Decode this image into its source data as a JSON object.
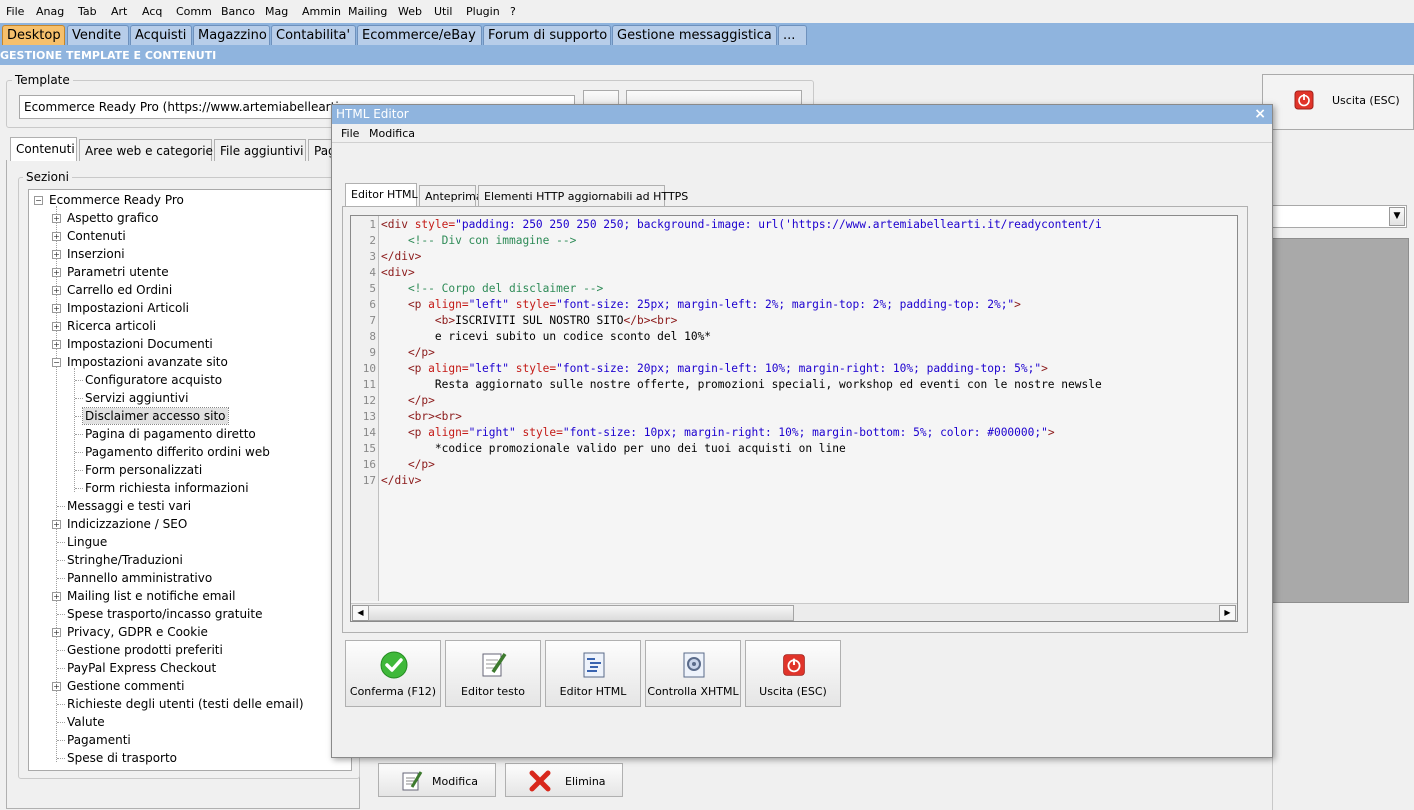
{
  "menubar": [
    "File",
    "Anag",
    "Tab",
    "Art",
    "Acq",
    "Comm",
    "Banco",
    "Mag",
    "Ammin",
    "Mailing",
    "Web",
    "Util",
    "Plugin",
    "?"
  ],
  "tabs": [
    "Desktop",
    "Vendite",
    "Acquisti",
    "Magazzino",
    "Contabilita'",
    "Ecommerce/eBay",
    "Forum di supporto",
    "Gestione messaggistica",
    "..."
  ],
  "section_title": "GESTIONE TEMPLATE E CONTENUTI",
  "template": {
    "legend": "Template",
    "value": "Ecommerce Ready Pro (https://www.artemiabellearti."
  },
  "exit_main": "Uscita (ESC)",
  "subtabs": [
    "Contenuti",
    "Aree web e categorie",
    "File aggiuntivi",
    "Pag"
  ],
  "sections_legend": "Sezioni",
  "tree": {
    "root": "Ecommerce Ready Pro",
    "items": [
      "Aspetto grafico",
      "Contenuti",
      "Inserzioni",
      "Parametri utente",
      "Carrello ed Ordini",
      "Impostazioni Articoli",
      "Ricerca articoli",
      "Impostazioni Documenti",
      "Impostazioni avanzate sito"
    ],
    "children": [
      "Configuratore acquisto",
      "Servizi aggiuntivi",
      "Disclaimer accesso sito",
      "Pagina di pagamento diretto",
      "Pagamento differito ordini web",
      "Form personalizzati",
      "Form richiesta informazioni"
    ],
    "items2": [
      "Messaggi e testi vari",
      "Indicizzazione / SEO",
      "Lingue",
      "Stringhe/Traduzioni",
      "Pannello amministrativo",
      "Mailing list e notifiche email",
      "Spese trasporto/incasso gratuite",
      "Privacy, GDPR e Cookie",
      "Gestione prodotti preferiti",
      "PayPal Express Checkout",
      "Gestione commenti",
      "Richieste degli utenti (testi delle email)",
      "Valute",
      "Pagamenti",
      "Spese di trasporto"
    ]
  },
  "bottom_buttons": {
    "modifica": "Modifica",
    "elimina": "Elimina"
  },
  "dialog": {
    "title": "HTML Editor",
    "menu": [
      "File",
      "Modifica"
    ],
    "tabs": [
      "Editor HTML",
      "Anteprima",
      "Elementi HTTP aggiornabili ad HTTPS"
    ],
    "line_numbers": [
      "1",
      "2",
      "3",
      "4",
      "5",
      "6",
      "7",
      "8",
      "9",
      "10",
      "11",
      "12",
      "13",
      "14",
      "15",
      "16",
      "17"
    ],
    "code": {
      "l1": {
        "t1": "<div",
        "a1": " style=",
        "v1": "\"padding: 250 250 250 250; background-image: url('https://www.artemiabellearti.it/readycontent/i"
      },
      "l2": "    <!-- Div con immagine -->",
      "l3": "</div>",
      "l4": "<div>",
      "l5": "    <!-- Corpo del disclaimer -->",
      "l6": {
        "t1": "    <p",
        "a1": " align=",
        "v1": "\"left\"",
        "a2": " style=",
        "v2": "\"font-size: 25px; margin-left: 2%; margin-top: 2%; padding-top: 2%;\"",
        "t2": ">"
      },
      "l7": {
        "t1": "        <b>",
        "x": "ISCRIVITI SUL NOSTRO SITO",
        "t2": "</b><br>"
      },
      "l8": "        e ricevi subito un codice sconto del 10%*",
      "l9": "    </p>",
      "l10": {
        "t1": "    <p",
        "a1": " align=",
        "v1": "\"left\"",
        "a2": " style=",
        "v2": "\"font-size: 20px; margin-left: 10%; margin-right: 10%; padding-top: 5%;\"",
        "t2": ">"
      },
      "l11": "        Resta aggiornato sulle nostre offerte, promozioni speciali, workshop ed eventi con le nostre newsle",
      "l12": "    </p>",
      "l13": "    <br><br>",
      "l14": {
        "t1": "    <p",
        "a1": " align=",
        "v1": "\"right\"",
        "a2": " style=",
        "v2": "\"font-size: 10px; margin-right: 10%; margin-bottom: 5%; color: #000000;\"",
        "t2": ">"
      },
      "l15": "        *codice promozionale valido per uno dei tuoi acquisti on line",
      "l16": "    </p>",
      "l17": "</div>"
    },
    "buttons": [
      "Conferma (F12)",
      "Editor testo",
      "Editor HTML",
      "Controlla XHTML",
      "Uscita (ESC)"
    ],
    "close": "×"
  },
  "icons": [
    "close-icon",
    "check-icon",
    "edit-text-icon",
    "html-editor-icon",
    "check-xhtml-icon",
    "exit-icon",
    "combo-arrow-icon"
  ]
}
